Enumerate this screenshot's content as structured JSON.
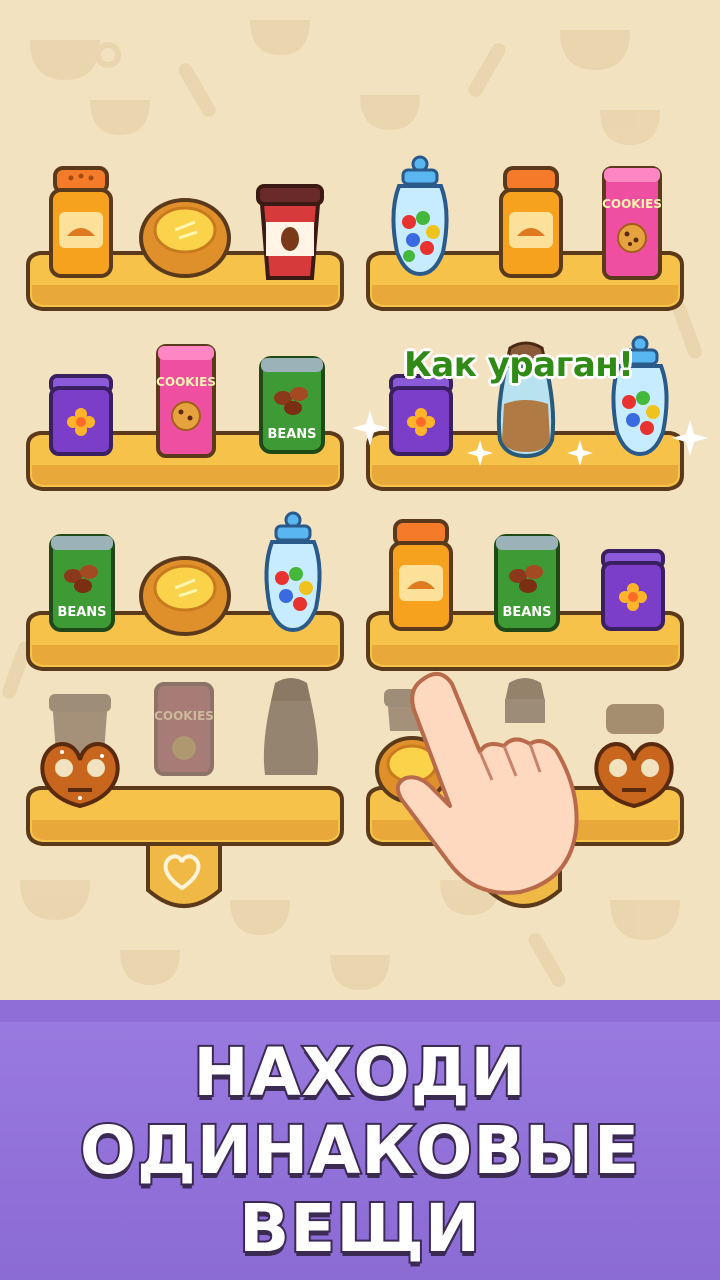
{
  "popup": {
    "text": "Как ураган!",
    "color": "#2f8a16"
  },
  "banner": {
    "lines": [
      "НАХОДИ",
      "ОДИНАКОВЫЕ",
      "ВЕЩИ"
    ],
    "background": "#9a7be0"
  },
  "shelves": [
    {
      "name": "shelf-1",
      "items": [
        "spice-jar",
        "lemon-pie",
        "coffee-cup"
      ],
      "dimmed": []
    },
    {
      "name": "shelf-2",
      "items": [
        "candy-jar",
        "spice-jar",
        "cookies-can"
      ],
      "dimmed": []
    },
    {
      "name": "shelf-3",
      "items": [
        "flower-tin",
        "cookies-can",
        "beans-can"
      ],
      "dimmed": []
    },
    {
      "name": "shelf-4",
      "items": [
        "flower-tin",
        "pepper-shaker",
        "candy-jar"
      ],
      "dimmed": [],
      "matched": true
    },
    {
      "name": "shelf-5",
      "items": [
        "beans-can",
        "lemon-pie",
        "candy-jar"
      ],
      "dimmed": []
    },
    {
      "name": "shelf-6",
      "items": [
        "spice-jar",
        "beans-can",
        "flower-tin"
      ],
      "dimmed": []
    },
    {
      "name": "shelf-7",
      "items": [
        "pretzel"
      ],
      "dimmed": [
        "coffee-cup",
        "cookies-can",
        "pepper-shaker"
      ]
    },
    {
      "name": "shelf-8",
      "items": [
        "lemon-pie",
        "pretzel"
      ],
      "dimmed": [
        "coffee-cup",
        "pepper-shaker",
        "spice-jar"
      ]
    }
  ],
  "item_labels": {
    "cookies": "COOKIES",
    "beans": "BEANS"
  },
  "colors": {
    "shelf": "#f7c24a",
    "shelf_dark": "#d9992a",
    "outline": "#5a3a1a",
    "background": "#f2e2c0"
  },
  "icons": [
    "heart-icon",
    "hand-pointer-icon",
    "sparkle-icon"
  ]
}
